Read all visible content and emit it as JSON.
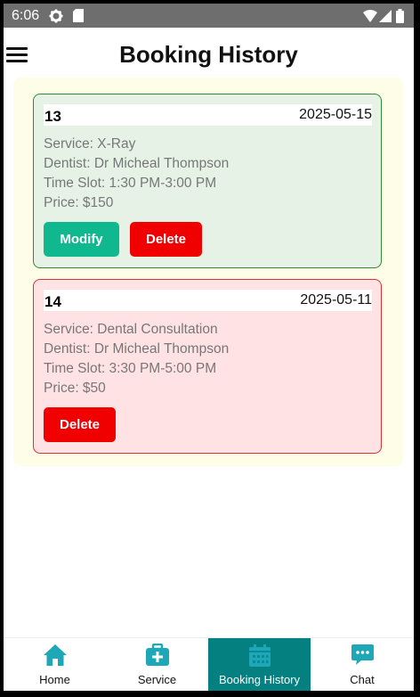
{
  "status_bar": {
    "time": "6:06"
  },
  "header": {
    "title": "Booking History"
  },
  "bookings": [
    {
      "id": "13",
      "date": "2025-05-15",
      "service": "Service: X-Ray",
      "dentist": "Dentist: Dr Micheal Thompson",
      "time_slot": "Time Slot: 1:30 PM-3:00 PM",
      "price": "Price: $150",
      "modify_label": "Modify",
      "delete_label": "Delete",
      "status_color": "#2e8b2e"
    },
    {
      "id": "14",
      "date": "2025-05-11",
      "service": "Service: Dental Consultation",
      "dentist": "Dentist: Dr Micheal Thompson",
      "time_slot": "Time Slot: 3:30 PM-5:00 PM",
      "price": "Price: $50",
      "delete_label": "Delete",
      "status_color": "#e03030"
    }
  ],
  "bottom_nav": {
    "items": [
      {
        "label": "Home",
        "icon": "home-icon"
      },
      {
        "label": "Service",
        "icon": "medical-kit-icon"
      },
      {
        "label": "Booking History",
        "icon": "calendar-icon",
        "active": true
      },
      {
        "label": "Chat",
        "icon": "chat-icon"
      }
    ],
    "active_color": "#058080",
    "icon_color": "#1ea7b6"
  }
}
